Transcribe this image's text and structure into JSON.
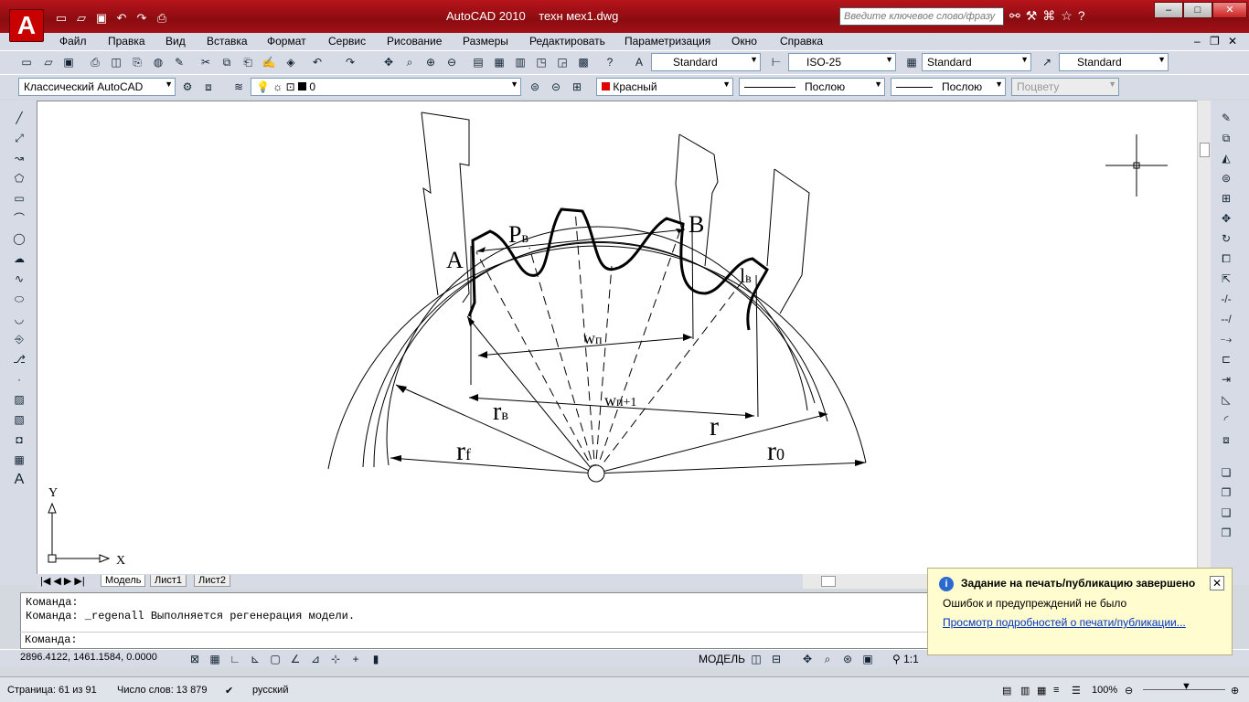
{
  "window": {
    "title": "AutoCAD 2010",
    "file": "техн мех1.dwg",
    "search_placeholder": "Введите ключевое слово/фразу",
    "min": "–",
    "max": "□",
    "close": "✕"
  },
  "menu": [
    "Файл",
    "Правка",
    "Вид",
    "Вставка",
    "Формат",
    "Сервис",
    "Рисование",
    "Размеры",
    "Редактировать",
    "Параметризация",
    "Окно",
    "Справка"
  ],
  "toolbar": {
    "text_style": "Standard",
    "dim_style": "ISO-25",
    "table_style": "Standard",
    "mleader_style": "Standard",
    "workspace": "Классический AutoCAD",
    "layer": "0",
    "color": "Красный",
    "linetype": "Послою",
    "lineweight": "Послою",
    "plotstyle": "Поцвету"
  },
  "drawing": {
    "labels": {
      "A": "A",
      "B": "B",
      "Pv": "P",
      "Pv_sub": "в",
      "lv": "l",
      "lv_sub": "в",
      "wp": "w",
      "wp_sub": "п",
      "wp1": "w",
      "wp1_sub": "п+1",
      "rv": "r",
      "rv_sub": "в",
      "r": "r",
      "rf": "r",
      "rf_sub": "f",
      "r0": "r",
      "r0_sub": "0"
    },
    "ucs": {
      "x": "X",
      "y": "Y"
    }
  },
  "tabs": [
    "Модель",
    "Лист1",
    "Лист2"
  ],
  "command": {
    "line1": "Команда:",
    "line2": "Команда:  _regenall Выполняется регенерация модели.",
    "prompt": "Команда:"
  },
  "status": {
    "coords": "2896.4122, 1461.1584, 0.0000",
    "model": "МОДЕЛЬ",
    "scale": "1:1"
  },
  "word": {
    "page": "Страница: 61 из 91",
    "words": "Число слов: 13 879",
    "lang": "русский",
    "zoom": "100%"
  },
  "popup": {
    "title": "Задание на печать/публикацию завершено",
    "message": "Ошибок и предупреждений не было",
    "link": "Просмотр подробностей о печати/публикации..."
  }
}
